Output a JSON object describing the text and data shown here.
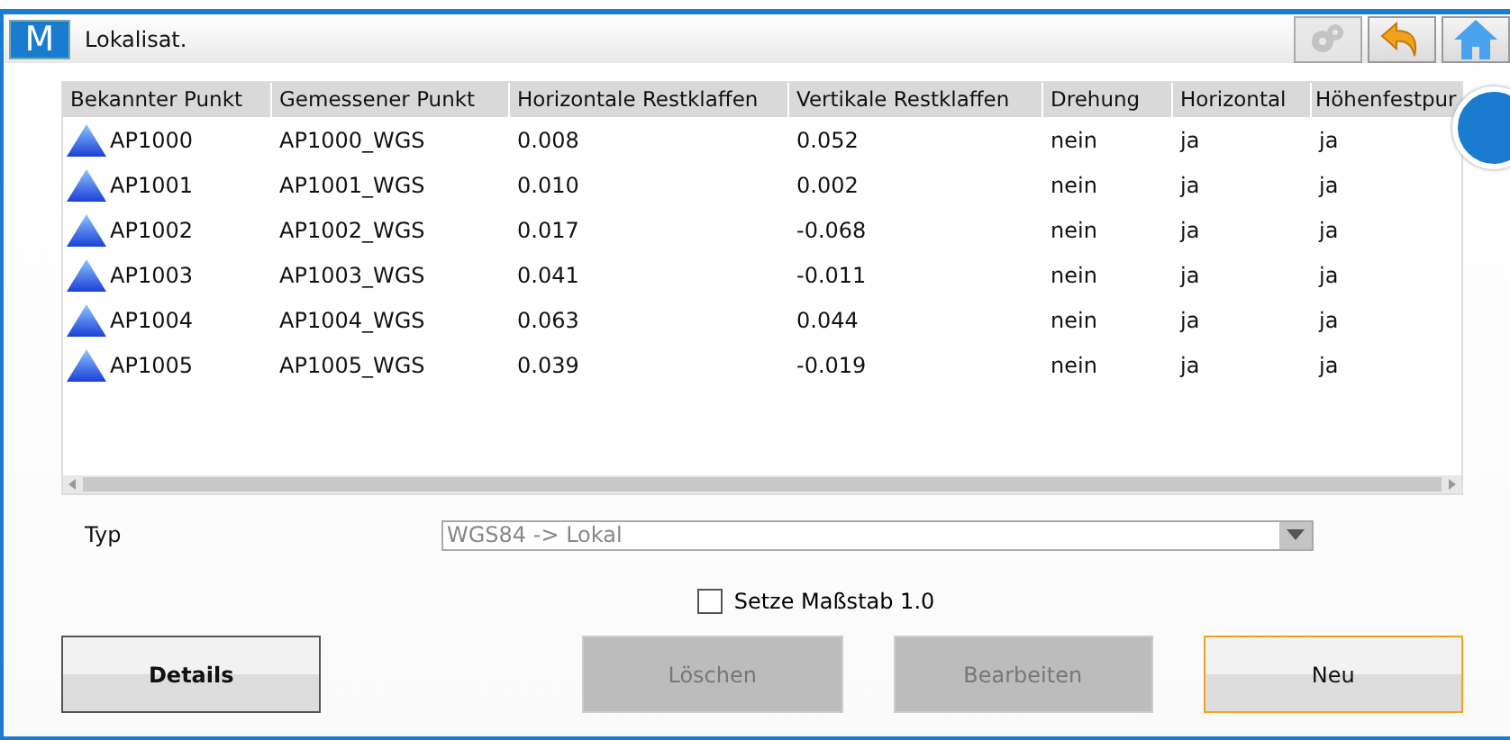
{
  "window": {
    "title": "Lokalisat.",
    "logo": "M"
  },
  "toolbar": [
    {
      "kind": "gear",
      "disabled": true
    },
    {
      "kind": "undo",
      "disabled": false
    },
    {
      "kind": "home",
      "disabled": false
    }
  ],
  "table": {
    "columns": [
      "Bekannter Punkt",
      "Gemessener Punkt",
      "Horizontale Restklaffen",
      "Vertikale Restklaffen",
      "Drehung",
      "Horizontal",
      "Höhenfestpur"
    ],
    "rows": [
      [
        "AP1000",
        "AP1000_WGS",
        "0.008",
        "0.052",
        "nein",
        "ja",
        "ja"
      ],
      [
        "AP1001",
        "AP1001_WGS",
        "0.010",
        "0.002",
        "nein",
        "ja",
        "ja"
      ],
      [
        "AP1002",
        "AP1002_WGS",
        "0.017",
        "-0.068",
        "nein",
        "ja",
        "ja"
      ],
      [
        "AP1003",
        "AP1003_WGS",
        "0.041",
        "-0.011",
        "nein",
        "ja",
        "ja"
      ],
      [
        "AP1004",
        "AP1004_WGS",
        "0.063",
        "0.044",
        "nein",
        "ja",
        "ja"
      ],
      [
        "AP1005",
        "AP1005_WGS",
        "0.039",
        "-0.019",
        "nein",
        "ja",
        "ja"
      ]
    ]
  },
  "type_field": {
    "label": "Typ",
    "value": "WGS84 -> Lokal",
    "disabled": true
  },
  "scale_checkbox": {
    "label": "Setze Maßstab 1.0",
    "checked": false
  },
  "buttons": [
    {
      "label": "Details",
      "disabled": false,
      "focused": false
    },
    {
      "label": "Löschen",
      "disabled": true,
      "focused": false
    },
    {
      "label": "Bearbeiten",
      "disabled": true,
      "focused": false
    },
    {
      "label": "Neu",
      "disabled": false,
      "focused": true
    }
  ]
}
